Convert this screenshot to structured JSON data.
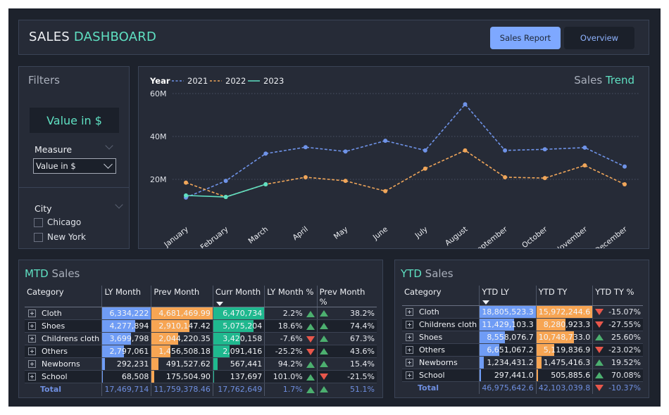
{
  "header": {
    "title_prefix": "SALES",
    "title_accent": "DASHBOARD",
    "buttons": [
      {
        "label": "Sales Report",
        "active": true
      },
      {
        "label": "Overview",
        "active": false
      }
    ]
  },
  "filters": {
    "title": "Filters",
    "card_value": "Value in $",
    "measure_label": "Measure",
    "measure_selected": "Value in $",
    "city_label": "City",
    "cities": [
      {
        "label": "Chicago",
        "checked": false
      },
      {
        "label": "New York",
        "checked": false
      }
    ]
  },
  "chart_header": {
    "title_prefix": "Sales",
    "title_accent": "Trend",
    "legend_title": "Year"
  },
  "chart_data": {
    "type": "line",
    "title": "Sales Trend",
    "xlabel": "",
    "ylabel": "",
    "ylim": [
      0,
      60000000
    ],
    "yticks": [
      20000000,
      40000000,
      60000000
    ],
    "ytick_labels": [
      "20M",
      "40M",
      "60M"
    ],
    "grid": true,
    "legend_position": "top-left",
    "categories": [
      "January",
      "February",
      "March",
      "April",
      "May",
      "June",
      "July",
      "August",
      "September",
      "October",
      "November",
      "December"
    ],
    "series": [
      {
        "name": "2021",
        "color": "#6f93e8",
        "dashed": true,
        "values": [
          11500000,
          19300000,
          32000000,
          35000000,
          33000000,
          38000000,
          33500000,
          55000000,
          33500000,
          34000000,
          34800000,
          26000000
        ]
      },
      {
        "name": "2022",
        "color": "#f0a65a",
        "dashed": true,
        "values": [
          18500000,
          11800000,
          17700000,
          21000000,
          19300000,
          14500000,
          25000000,
          33500000,
          21000000,
          20600000,
          26500000,
          17700000
        ]
      },
      {
        "name": "2023",
        "color": "#5fe0c2",
        "dashed": false,
        "values": [
          12500000,
          11800000,
          17700000,
          null,
          null,
          null,
          null,
          null,
          null,
          null,
          null,
          null
        ]
      }
    ]
  },
  "mtd": {
    "title_accent": "MTD",
    "title_rest": "Sales",
    "columns": [
      "Category",
      "LY Month",
      "Prev Month",
      "Curr Month",
      "LY Month %",
      "Prev Month %"
    ],
    "sorted_column": "Curr Month",
    "bar_colors": {
      "ly": "#6f9cf5",
      "prev": "#f7a553",
      "curr": "#1fb88e"
    },
    "rows": [
      {
        "category": "Cloth",
        "ly": "6,334,222",
        "ly_frac": 1.0,
        "prev": "4,681,469.99",
        "prev_frac": 1.0,
        "curr": "6,470,734",
        "curr_frac": 1.0,
        "ly_pct": "2.2%",
        "ly_dir": "up",
        "prev_pct": "38.2%",
        "prev_dir": "up"
      },
      {
        "category": "Shoes",
        "ly": "4,277,894",
        "ly_frac": 0.675,
        "prev": "2,910,147.42",
        "prev_frac": 0.62,
        "curr": "5,075,204",
        "curr_frac": 0.784,
        "ly_pct": "18.6%",
        "ly_dir": "up",
        "prev_pct": "74.4%",
        "prev_dir": "up"
      },
      {
        "category": "Childrens cloth",
        "ly": "3,699,798",
        "ly_frac": 0.584,
        "prev": "2,044,220.35",
        "prev_frac": 0.437,
        "curr": "3,420,158",
        "curr_frac": 0.529,
        "ly_pct": "-7.6%",
        "ly_dir": "down",
        "prev_pct": "67.3%",
        "prev_dir": "up"
      },
      {
        "category": "Others",
        "ly": "2,797,061",
        "ly_frac": 0.442,
        "prev": "1,456,508.18",
        "prev_frac": 0.311,
        "curr": "2,091,416",
        "curr_frac": 0.323,
        "ly_pct": "-25.2%",
        "ly_dir": "down",
        "prev_pct": "43.6%",
        "prev_dir": "up"
      },
      {
        "category": "Newborns",
        "ly": "292,231",
        "ly_frac": 0.046,
        "prev": "491,527.62",
        "prev_frac": 0.105,
        "curr": "567,441",
        "curr_frac": 0.088,
        "ly_pct": "94.2%",
        "ly_dir": "up",
        "prev_pct": "15.4%",
        "prev_dir": "up"
      },
      {
        "category": "School",
        "ly": "68,508",
        "ly_frac": 0.011,
        "prev": "175,504.90",
        "prev_frac": 0.037,
        "curr": "137,697",
        "curr_frac": 0.021,
        "ly_pct": "101.0%",
        "ly_dir": "up",
        "prev_pct": "-21.5%",
        "prev_dir": "down"
      }
    ],
    "total": {
      "label": "Total",
      "ly": "17,469,714",
      "prev": "11,759,378.46",
      "curr": "17,762,649",
      "ly_pct": "1.7%",
      "ly_dir": "up",
      "prev_pct": "51.1%",
      "prev_dir": "up"
    }
  },
  "ytd": {
    "title_accent": "YTD",
    "title_rest": "Sales",
    "columns": [
      "Category",
      "YTD LY",
      "YTD TY",
      "YTD TY %"
    ],
    "sorted_column": "YTD LY",
    "bar_colors": {
      "ly": "#6f9cf5",
      "ty": "#f7a553"
    },
    "rows": [
      {
        "category": "Cloth",
        "ly": "18,805,523.3",
        "ly_frac": 1.0,
        "ty": "15,972,244.6",
        "ty_frac": 1.0,
        "pct": "-15.07%",
        "dir": "down"
      },
      {
        "category": "Childrens cloth",
        "ly": "11,429,103.3",
        "ly_frac": 0.608,
        "ty": "8,280,923.3",
        "ty_frac": 0.518,
        "pct": "-27.55%",
        "dir": "down"
      },
      {
        "category": "Shoes",
        "ly": "8,558,076.7",
        "ly_frac": 0.455,
        "ty": "10,748,733.0",
        "ty_frac": 0.673,
        "pct": "25.60%",
        "dir": "up"
      },
      {
        "category": "Others",
        "ly": "6,651,067.2",
        "ly_frac": 0.354,
        "ty": "5,119,836.9",
        "ty_frac": 0.32,
        "pct": "-23.02%",
        "dir": "down"
      },
      {
        "category": "Newborns",
        "ly": "1,234,431.2",
        "ly_frac": 0.066,
        "ty": "1,475,416.3",
        "ty_frac": 0.092,
        "pct": "19.52%",
        "dir": "up"
      },
      {
        "category": "School",
        "ly": "297,441.0",
        "ly_frac": 0.016,
        "ty": "505,885.6",
        "ty_frac": 0.032,
        "pct": "70.08%",
        "dir": "up"
      }
    ],
    "total": {
      "label": "Total",
      "ly": "46,975,642.6",
      "ty": "42,103,039.8",
      "pct": "-10.37%",
      "dir": "down"
    }
  }
}
